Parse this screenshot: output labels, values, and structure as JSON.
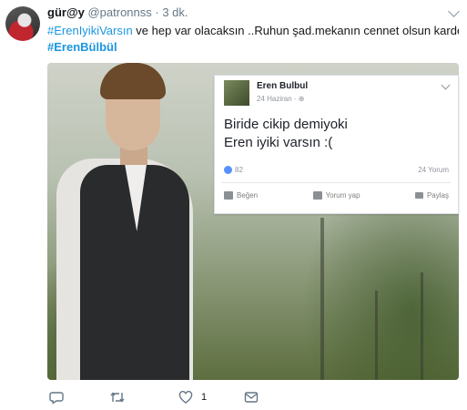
{
  "tweet": {
    "display_name": "gür@y",
    "handle": "@patronnss",
    "separator": " · ",
    "time": "3 dk.",
    "hashtag1": "#ErenIyikiVarsın",
    "text": " ve hep var olacaksın ..Ruhun şad.mekanın cennet olsun kardeşim...",
    "hashtag2": "#ErenBülbül",
    "like_count": "1"
  },
  "embedded_post": {
    "author": "Eren Bulbul",
    "date": "24 Haziran · ⊕",
    "line1": "Biride cikip demiyoki",
    "line2": "Eren iyiki varsın :(",
    "likes": "82",
    "comments": "24 Yorum",
    "action_like": "Beğen",
    "action_comment": "Yorum yap",
    "action_share": "Paylaş"
  },
  "icons": [
    "reply-icon",
    "retweet-icon",
    "like-icon",
    "message-icon",
    "caret-down-icon"
  ],
  "colors": {
    "link": "#1b95e0",
    "secondary": "#657786",
    "fb_like": "#5890ff"
  }
}
